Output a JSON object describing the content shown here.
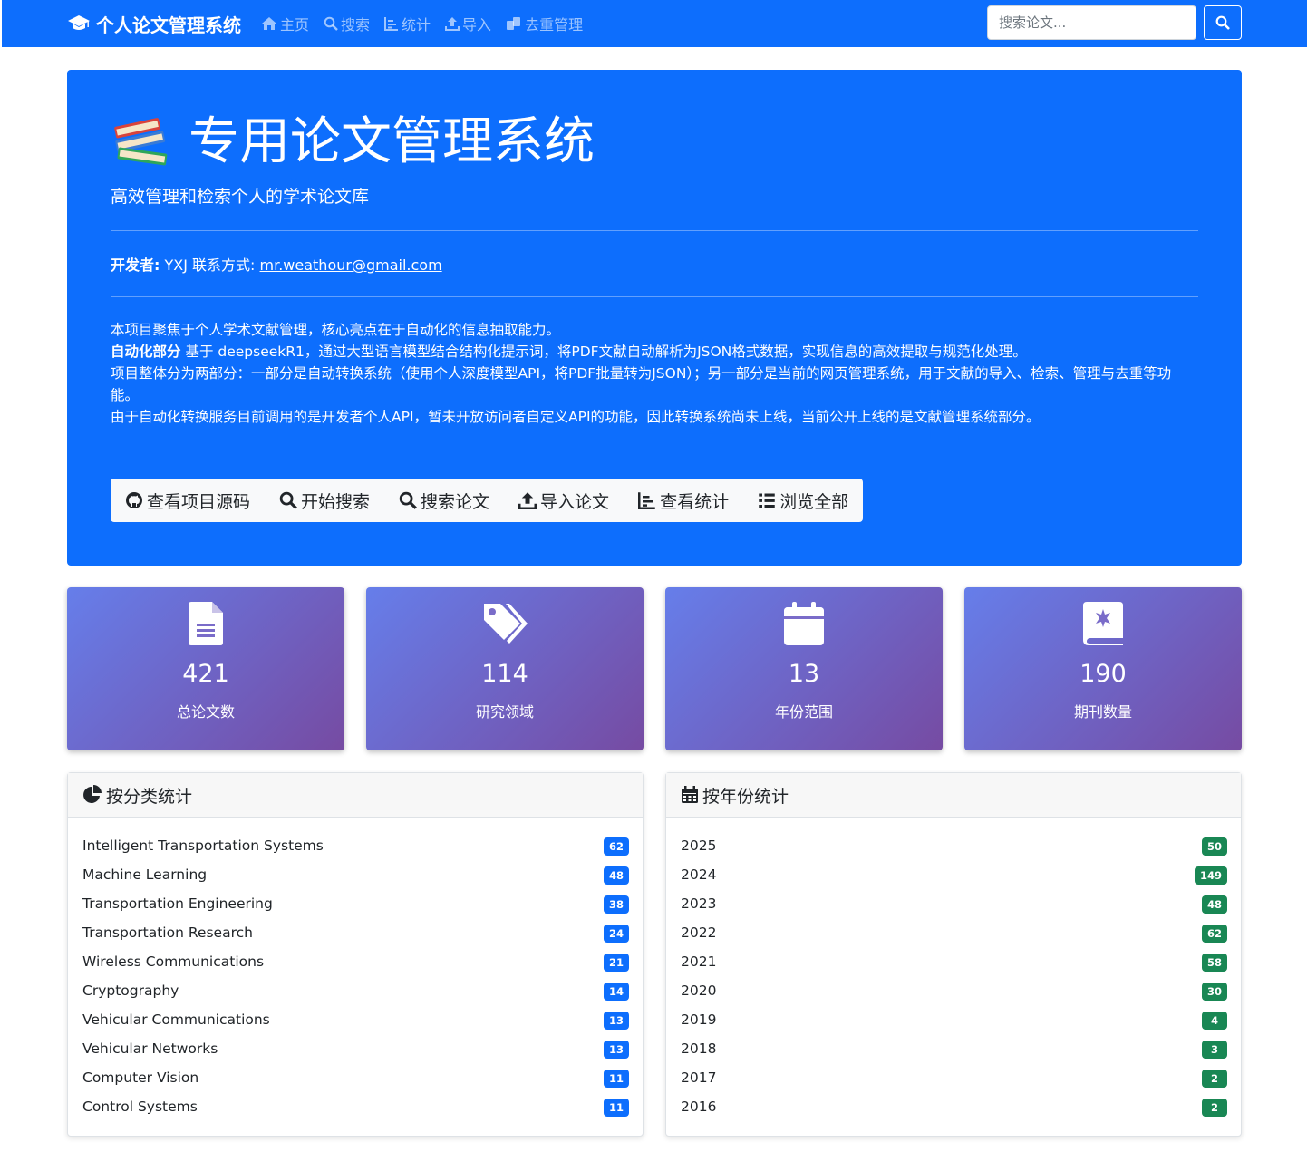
{
  "navbar": {
    "brand": "个人论文管理系统",
    "links": [
      {
        "label": "主页",
        "icon": "home-icon"
      },
      {
        "label": "搜索",
        "icon": "search-icon"
      },
      {
        "label": "统计",
        "icon": "chart-icon"
      },
      {
        "label": "导入",
        "icon": "upload-icon"
      },
      {
        "label": "去重管理",
        "icon": "copy-icon"
      }
    ],
    "search_placeholder": "搜索论文..."
  },
  "hero": {
    "title": "专用论文管理系统",
    "subtitle": "高效管理和检索个人的学术论文库",
    "developer_label": "开发者:",
    "developer_name": " YXJ 联系方式: ",
    "email": "mr.weathour@gmail.com",
    "desc_line1": "本项目聚焦于个人学术文献管理，核心亮点在于自动化的信息抽取能力。",
    "desc_line2_bold": "自动化部分",
    "desc_line2": " 基于 deepseekR1，通过大型语言模型结合结构化提示词，将PDF文献自动解析为JSON格式数据，实现信息的高效提取与规范化处理。",
    "desc_line3": "项目整体分为两部分：一部分是自动转换系统（使用个人深度模型API，将PDF批量转为JSON）；另一部分是当前的网页管理系统，用于文献的导入、检索、管理与去重等功能。",
    "desc_line4": "由于自动化转换服务目前调用的是开发者个人API，暂未开放访问者自定义API的功能，因此转换系统尚未上线，当前公开上线的是文献管理系统部分。",
    "buttons": [
      {
        "label": "查看项目源码",
        "icon": "github-icon"
      },
      {
        "label": "开始搜索",
        "icon": "search-icon"
      },
      {
        "label": "搜索论文",
        "icon": "search-icon"
      },
      {
        "label": "导入论文",
        "icon": "upload-icon"
      },
      {
        "label": "查看统计",
        "icon": "chart-icon"
      },
      {
        "label": "浏览全部",
        "icon": "list-icon"
      }
    ]
  },
  "stats": [
    {
      "value": "421",
      "label": "总论文数",
      "icon": "file-icon"
    },
    {
      "value": "114",
      "label": "研究领域",
      "icon": "tags-icon"
    },
    {
      "value": "13",
      "label": "年份范围",
      "icon": "calendar-icon"
    },
    {
      "value": "190",
      "label": "期刊数量",
      "icon": "journal-icon"
    }
  ],
  "category_panel": {
    "title": "按分类统计",
    "rows": [
      {
        "name": "Intelligent Transportation Systems",
        "count": "62"
      },
      {
        "name": "Machine Learning",
        "count": "48"
      },
      {
        "name": "Transportation Engineering",
        "count": "38"
      },
      {
        "name": "Transportation Research",
        "count": "24"
      },
      {
        "name": "Wireless Communications",
        "count": "21"
      },
      {
        "name": "Cryptography",
        "count": "14"
      },
      {
        "name": "Vehicular Communications",
        "count": "13"
      },
      {
        "name": "Vehicular Networks",
        "count": "13"
      },
      {
        "name": "Computer Vision",
        "count": "11"
      },
      {
        "name": "Control Systems",
        "count": "11"
      }
    ]
  },
  "year_panel": {
    "title": "按年份统计",
    "rows": [
      {
        "name": "2025",
        "count": "50"
      },
      {
        "name": "2024",
        "count": "149"
      },
      {
        "name": "2023",
        "count": "48"
      },
      {
        "name": "2022",
        "count": "62"
      },
      {
        "name": "2021",
        "count": "58"
      },
      {
        "name": "2020",
        "count": "30"
      },
      {
        "name": "2019",
        "count": "4"
      },
      {
        "name": "2018",
        "count": "3"
      },
      {
        "name": "2017",
        "count": "2"
      },
      {
        "name": "2016",
        "count": "2"
      }
    ]
  },
  "colors": {
    "primary": "#0d6efd",
    "badge_blue": "#0d6efd",
    "badge_green": "#198754",
    "gradient_start": "#667eea",
    "gradient_end": "#764ba2"
  }
}
